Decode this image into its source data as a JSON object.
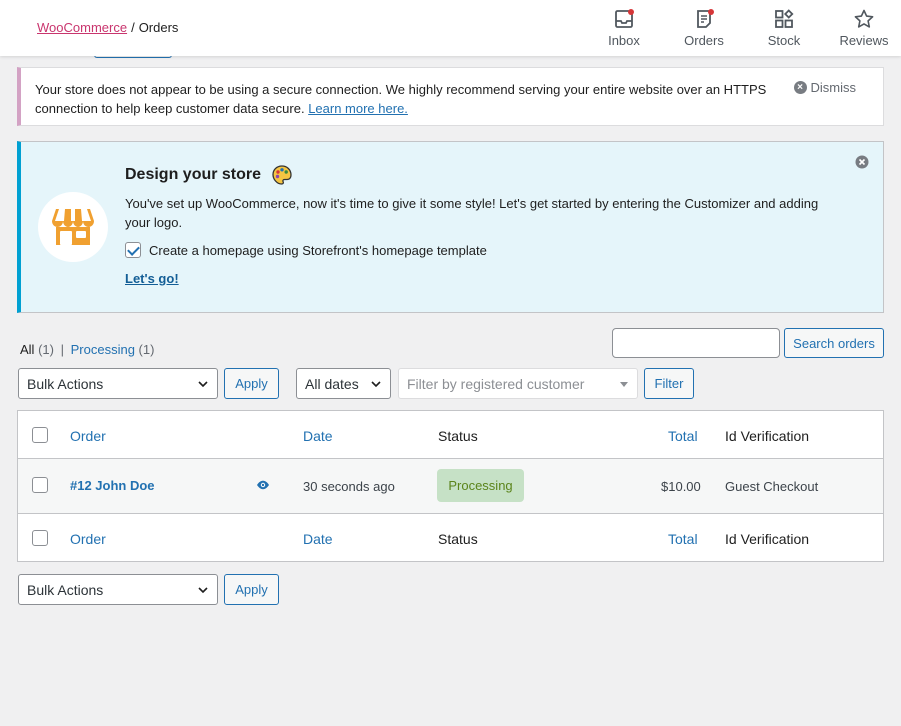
{
  "header": {
    "breadcrumb_root": "WooCommerce",
    "breadcrumb_sep": "/",
    "breadcrumb_current": "Orders",
    "activity": [
      {
        "label": "Inbox",
        "icon": "inbox-icon",
        "has_dot": true
      },
      {
        "label": "Orders",
        "icon": "orders-icon",
        "has_dot": true
      },
      {
        "label": "Stock",
        "icon": "stock-icon",
        "has_dot": false
      },
      {
        "label": "Reviews",
        "icon": "star-icon",
        "has_dot": false
      }
    ]
  },
  "notice": {
    "text": "Your store does not appear to be using a secure connection. We highly recommend serving your entire website over an HTTPS connection to help keep customer data secure.",
    "link": "Learn more here.",
    "dismiss": "Dismiss"
  },
  "design": {
    "title": "Design your store",
    "description": "You've set up WooCommerce, now it's time to give it some style! Let's get started by entering the Customizer and adding your logo.",
    "checkbox_label": "Create a homepage using Storefront's homepage template",
    "checkbox_checked": true,
    "cta": "Let's go!"
  },
  "filters": {
    "all_label": "All",
    "all_count": "(1)",
    "sep": "|",
    "processing_label": "Processing",
    "processing_count": "(1)",
    "search_value": "",
    "search_button": "Search orders",
    "bulk_actions": "Bulk Actions",
    "apply": "Apply",
    "dates": "All dates",
    "customer_placeholder": "Filter by registered customer",
    "filter_button": "Filter"
  },
  "table": {
    "columns": {
      "order": "Order",
      "date": "Date",
      "status": "Status",
      "total": "Total",
      "id_verification": "Id Verification"
    },
    "rows": [
      {
        "order": "#12 John Doe",
        "date": "30 seconds ago",
        "status": "Processing",
        "total": "$10.00",
        "id_verification": "Guest Checkout"
      }
    ]
  },
  "bottom": {
    "bulk_actions": "Bulk Actions",
    "apply": "Apply"
  },
  "colors": {
    "accent": "#2271b1",
    "brand": "#c9356e",
    "processing_bg": "#c6e1c6",
    "processing_text": "#5b841b",
    "design_border": "#00a0d2"
  }
}
